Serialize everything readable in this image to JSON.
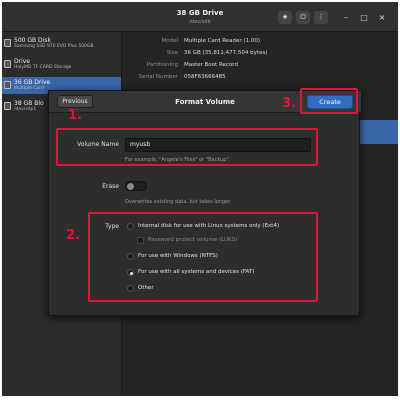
{
  "window": {
    "title": "38 GB Drive",
    "subtitle": "/dev/sdb",
    "star_icon": "star-icon",
    "power_icon": "power-icon",
    "menu_icon": "more-icon",
    "minimize": "–",
    "maximize": "□",
    "close": "×"
  },
  "sidebar": {
    "items": [
      {
        "name": "500 GB Disk",
        "desc": "Samsung SSD 970 EVO Plus 500GB",
        "selected": false
      },
      {
        "name": "Drive",
        "desc": "HolyMD TF CARD Storage",
        "selected": false
      },
      {
        "name": "36 GB Drive",
        "desc": "Multiple Card",
        "selected": true
      },
      {
        "name": "38 GB Blo",
        "desc": "/dev/sdp1",
        "selected": false
      }
    ]
  },
  "drive_info": [
    {
      "key": "Model",
      "value": "Multiple Card  Reader (1.00)"
    },
    {
      "key": "Size",
      "value": "36 GB (35,811,477,504 bytes)"
    },
    {
      "key": "Partitioning",
      "value": "Master Boot Record"
    },
    {
      "key": "Serial Number",
      "value": "058F63666485"
    }
  ],
  "dialog": {
    "previous_label": "Previous",
    "title": "Format Volume",
    "create_label": "Create",
    "volume_name_label": "Volume Name",
    "volume_name_value": "myusb",
    "volume_name_hint": "For example, \"Angela's Files\" or \"Backup\".",
    "erase_label": "Erase",
    "erase_hint": "Overwrites existing data, but takes longer.",
    "type_label": "Type",
    "type_options": [
      {
        "label": "Internal disk for use with Linux systems only (Ext4)",
        "selected": false
      },
      {
        "label": "For use with Windows (NTFS)",
        "selected": false
      },
      {
        "label": "For use with all systems and devices (FAT)",
        "selected": true
      },
      {
        "label": "Other",
        "selected": false
      }
    ],
    "password_protect_label": "Password protect volume (LUKS)"
  },
  "annotations": {
    "label_1": "1.",
    "label_2": "2.",
    "label_3": "3.",
    "color": "#e0143c"
  },
  "colors": {
    "accent": "#2f6ec4",
    "selection": "#3a67a8",
    "annotation": "#e0143c"
  }
}
